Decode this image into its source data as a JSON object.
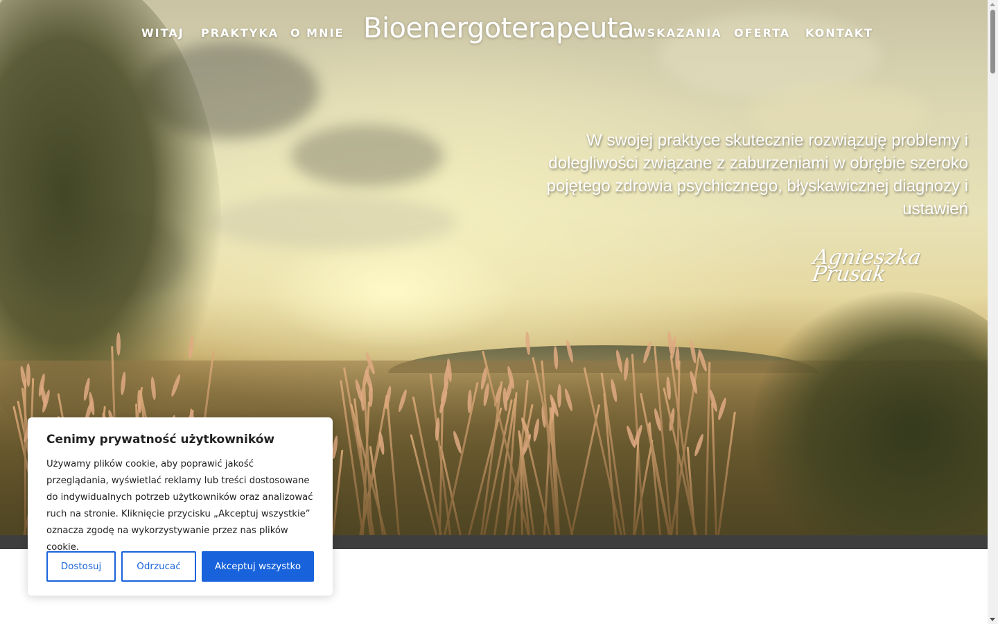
{
  "header": {
    "brand": "Bioenergoterapeuta",
    "nav_left": [
      "WITAJ",
      "PRAKTYKA",
      "O MNIE"
    ],
    "nav_right": [
      "WSKAZANIA",
      "OFERTA",
      "KONTAKT"
    ]
  },
  "hero": {
    "tagline": "W swojej praktyce skutecznie rozwiązuję problemy i dolegliwości związane z zaburzeniami w obrębie szeroko pojętego zdrowia psychicznego, błyskawicznej diagnozy i ustawień",
    "signature_first": "Agnieszka",
    "signature_last": "Prusak"
  },
  "cookie": {
    "title": "Cenimy prywatność użytkowników",
    "text": "Używamy plików cookie, aby poprawić jakość przeglądania, wyświetlać reklamy lub treści dostosowane do indywidualnych potrzeb użytkowników oraz analizować ruch na stronie. Kliknięcie przycisku „Akceptuj wszystkie” oznacza zgodę na wykorzystywanie przez nas plików cookie.",
    "customize_label": "Dostosuj",
    "reject_label": "Odrzucać",
    "accept_label": "Akceptuj wszystko"
  },
  "colors": {
    "accent": "#1863dc",
    "strip": "#3e3e3e"
  }
}
